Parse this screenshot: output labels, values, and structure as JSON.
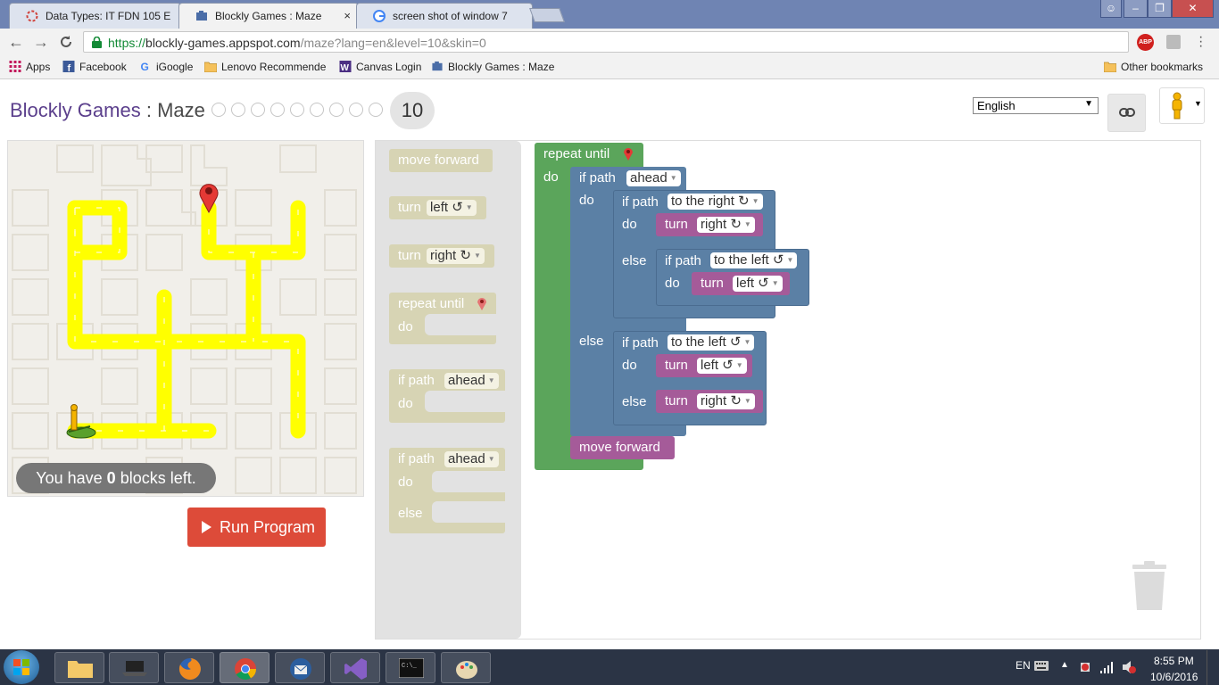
{
  "browser": {
    "tabs": [
      {
        "label": "Data Types: IT FDN 105 E",
        "close": "×"
      },
      {
        "label": "Blockly Games : Maze",
        "close": "×"
      },
      {
        "label": "screen shot of window 7",
        "close": "×"
      }
    ],
    "window_controls": {
      "minimize": "–",
      "maximize": "❐",
      "close": "✕"
    },
    "address": {
      "scheme": "https://",
      "host": "blockly-games.appspot.com",
      "path": "/maze?lang=en&level=10&skin=0"
    },
    "nav": {
      "back": "←",
      "forward": "→",
      "reload": "C"
    },
    "bookmarks": [
      {
        "label": "Apps",
        "icon": "apps-grid-icon"
      },
      {
        "label": "Facebook",
        "icon": "facebook-icon"
      },
      {
        "label": "iGoogle",
        "icon": "google-icon"
      },
      {
        "label": "Lenovo Recommende",
        "icon": "folder-icon"
      },
      {
        "label": "Canvas Login",
        "icon": "canvas-icon"
      },
      {
        "label": "Blockly Games : Maze",
        "icon": "blockly-icon"
      }
    ],
    "other_bookmarks": "Other bookmarks",
    "extension_abp": "ABP"
  },
  "header": {
    "brand": "Blockly Games",
    "separator": " : ",
    "app": "Maze",
    "current_level": "10",
    "total_levels": 10,
    "language": "English"
  },
  "maze": {
    "capacity_prefix": "You have ",
    "capacity_count": "0",
    "capacity_suffix": " blocks left.",
    "run_label": "Run Program"
  },
  "toolbox": {
    "move_forward": "move forward",
    "turn": "turn",
    "left": "left ↺",
    "right": "right ↻",
    "repeat_until": "repeat until",
    "do": "do",
    "else": "else",
    "if_path": "if path",
    "ahead": "ahead"
  },
  "program": {
    "repeat_until": "repeat until",
    "do": "do",
    "else": "else",
    "if_path": "if path",
    "ahead": "ahead",
    "to_the_right": "to the right ↻",
    "to_the_left": "to the left ↺",
    "turn": "turn",
    "right": "right ↻",
    "left": "left ↺",
    "move_forward": "move forward"
  },
  "taskbar": {
    "lang": "EN",
    "time": "8:55 PM",
    "date": "10/6/2016"
  }
}
